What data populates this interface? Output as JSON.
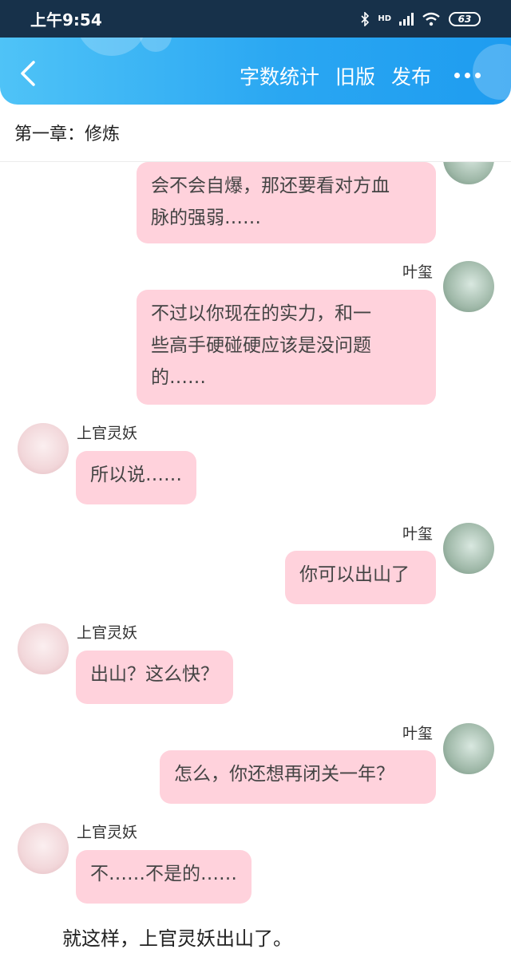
{
  "status": {
    "time": "上午9:54",
    "network": "HD",
    "battery": "63"
  },
  "appbar": {
    "actions": [
      "字数统计",
      "旧版",
      "发布"
    ]
  },
  "chapter": {
    "title": "第一章：修炼"
  },
  "messages": [
    {
      "side": "right",
      "name": "",
      "lines": [
        "会不会自爆，那还要看对方血",
        "脉的强弱……"
      ]
    },
    {
      "side": "right",
      "name": "叶玺",
      "lines": [
        "不过以你现在的实力，和一",
        "些高手硬碰硬应该是没问题",
        "的……"
      ]
    },
    {
      "side": "left",
      "name": "上官灵妖",
      "lines": [
        "所以说……"
      ]
    },
    {
      "side": "right",
      "name": "叶玺",
      "lines": [
        "你可以出山了"
      ]
    },
    {
      "side": "left",
      "name": "上官灵妖",
      "lines": [
        "出山？这么快？"
      ]
    },
    {
      "side": "right",
      "name": "叶玺",
      "lines": [
        "怎么，你还想再闭关一年？"
      ]
    },
    {
      "side": "left",
      "name": "上官灵妖",
      "lines": [
        "不……不是的……"
      ]
    }
  ],
  "narration": "就这样，上官灵妖出山了。",
  "colors": {
    "bubble": "#ffd2dc",
    "header_start": "#4fc3f7",
    "header_end": "#1e9cf0"
  }
}
